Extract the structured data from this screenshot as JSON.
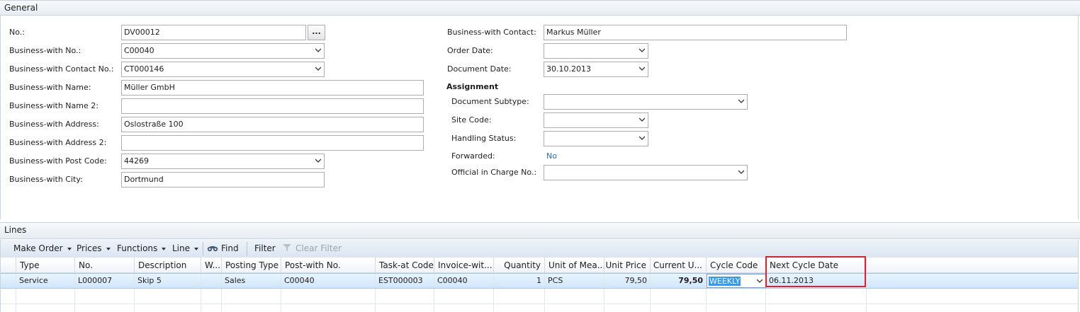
{
  "general": {
    "title": "General",
    "left_fields": [
      {
        "label": "No.:",
        "value": "DV00012",
        "type": "assist"
      },
      {
        "label": "Business-with No.:",
        "value": "C00040",
        "type": "dropdown"
      },
      {
        "label": "Business-with Contact No.:",
        "value": "CT000146",
        "type": "dropdown"
      },
      {
        "label": "Business-with Name:",
        "value": "Müller GmbH",
        "type": "text"
      },
      {
        "label": "Business-with Name 2:",
        "value": "",
        "type": "text"
      },
      {
        "label": "Business-with Address:",
        "value": "Oslostraße 100",
        "type": "text"
      },
      {
        "label": "Business-with Address 2:",
        "value": "",
        "type": "text"
      },
      {
        "label": "Business-with Post Code:",
        "value": "44269",
        "type": "dropdown"
      },
      {
        "label": "Business-with City:",
        "value": "Dortmund",
        "type": "text"
      }
    ],
    "assist_button": "...",
    "right_fields": [
      {
        "label": "Business-with Contact:",
        "value": "Markus Müller"
      },
      {
        "label": "Order Date:",
        "value": ""
      },
      {
        "label": "Document Date:",
        "value": "30.10.2013"
      }
    ],
    "assignment": {
      "heading": "Assignment",
      "fields": [
        {
          "label": "Document Subtype:",
          "value": ""
        },
        {
          "label": "Site Code:",
          "value": ""
        },
        {
          "label": "Handling Status:",
          "value": ""
        },
        {
          "label": "Forwarded:",
          "value": "No"
        },
        {
          "label": "Official in Charge No.:",
          "value": ""
        }
      ]
    }
  },
  "lines": {
    "title": "Lines",
    "toolbar": {
      "make_order": "Make Order",
      "prices": "Prices",
      "functions": "Functions",
      "line": "Line",
      "find": "Find",
      "filter": "Filter",
      "clear_filter": "Clear Filter"
    },
    "columns": [
      "Type",
      "No.",
      "Description",
      "W...",
      "Posting Type",
      "Post-with No.",
      "Task-at Code",
      "Invoice-wit...",
      "Quantity",
      "Unit of Mea...",
      "Unit Price",
      "Current U...",
      "Cycle Code",
      "Next Cycle Date"
    ],
    "rows": [
      {
        "type": "Service",
        "no": "L000007",
        "description": "Skip 5",
        "w": "",
        "posting_type": "Sales",
        "post_with_no": "C00040",
        "task_at_code": "EST000003",
        "invoice_with": "C00040",
        "quantity": "1",
        "unit_of_measure": "PCS",
        "unit_price": "79,50",
        "current_u": "79,50",
        "cycle_code": "WEEKLY",
        "next_cycle_date": "06.11.2013"
      }
    ]
  },
  "colors": {
    "highlight_border": "#e0202a",
    "link": "#2e6db5",
    "selected_row": "#cfe6fa",
    "selection": "#3399ff"
  }
}
